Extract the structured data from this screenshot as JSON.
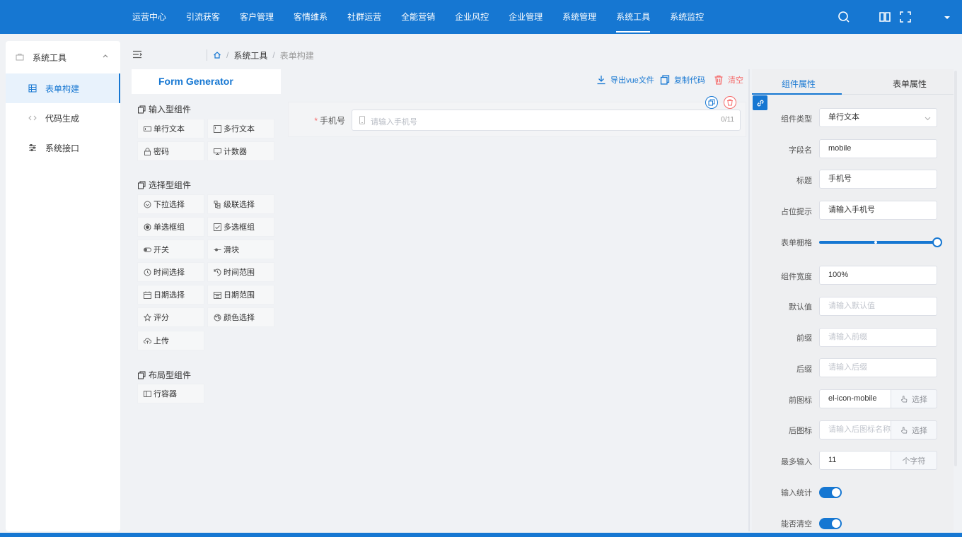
{
  "top_menu": [
    "运营中心",
    "引流获客",
    "客户管理",
    "客情维系",
    "社群运营",
    "全能营销",
    "企业风控",
    "企业管理",
    "系统管理",
    "系统工具",
    "系统监控"
  ],
  "top_menu_active": "系统工具",
  "sidebar": {
    "group": "系统工具",
    "items": [
      {
        "label": "表单构建",
        "active": true
      },
      {
        "label": "代码生成",
        "active": false
      },
      {
        "label": "系统接口",
        "active": false
      }
    ]
  },
  "breadcrumb": {
    "items": [
      "系统工具",
      "表单构建"
    ]
  },
  "palette": {
    "title": "Form Generator",
    "categories": [
      {
        "title": "输入型组件",
        "items": [
          "单行文本",
          "多行文本",
          "密码",
          "计数器"
        ]
      },
      {
        "title": "选择型组件",
        "items": [
          "下拉选择",
          "级联选择",
          "单选框组",
          "多选框组",
          "开关",
          "滑块",
          "时间选择",
          "时间范围",
          "日期选择",
          "日期范围",
          "评分",
          "颜色选择",
          "上传"
        ]
      },
      {
        "title": "布局型组件",
        "items": [
          "行容器"
        ]
      }
    ]
  },
  "toolbar": {
    "export": "导出vue文件",
    "copy": "复制代码",
    "clear": "清空"
  },
  "canvas": {
    "field": {
      "label": "手机号",
      "placeholder": "请输入手机号",
      "counter": "0/11"
    }
  },
  "props": {
    "tabs": [
      "组件属性",
      "表单属性"
    ],
    "rows": {
      "type": {
        "label": "组件类型",
        "value": "单行文本"
      },
      "field": {
        "label": "字段名",
        "value": "mobile"
      },
      "title": {
        "label": "标题",
        "value": "手机号"
      },
      "placeholder": {
        "label": "占位提示",
        "value": "请输入手机号"
      },
      "grid": {
        "label": "表单栅格",
        "value": 1.0
      },
      "width": {
        "label": "组件宽度",
        "value": "100%"
      },
      "default": {
        "label": "默认值",
        "placeholder": "请输入默认值"
      },
      "prefix": {
        "label": "前缀",
        "placeholder": "请输入前缀"
      },
      "suffix": {
        "label": "后缀",
        "placeholder": "请输入后缀"
      },
      "prefix_icon": {
        "label": "前图标",
        "value": "el-icon-mobile",
        "button": "选择"
      },
      "suffix_icon": {
        "label": "后图标",
        "placeholder": "请输入后图标名称",
        "button": "选择"
      },
      "maxlength": {
        "label": "最多输入",
        "value": "11",
        "append": "个字符"
      },
      "show_count": {
        "label": "输入统计",
        "on": true
      },
      "clearable": {
        "label": "能否清空",
        "on": true
      }
    }
  },
  "colors": {
    "primary": "#1677d2",
    "danger": "#f56c6c"
  }
}
